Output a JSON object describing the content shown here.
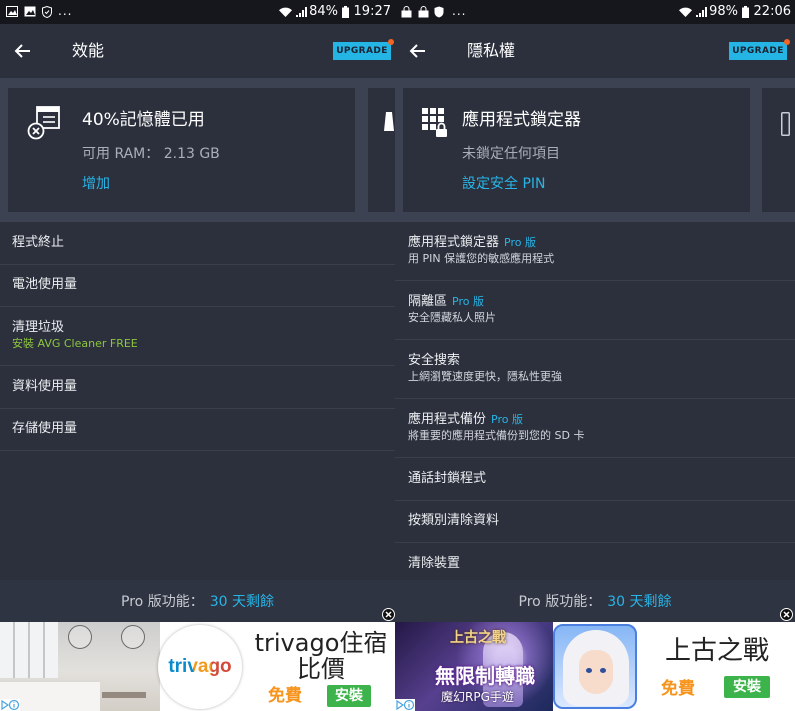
{
  "theme": {
    "background": "#2b303c",
    "card_area": "#3c4251",
    "card": "#2c303d",
    "accent": "#28b4e6",
    "upgrade_dot": "#f26522",
    "cleaner_green": "#8dc63f",
    "free_orange": "#f7941d",
    "install_green": "#3cb44b"
  },
  "left": {
    "status_bar": {
      "icons": [
        "gallery-icon",
        "image-icon",
        "shield-icon",
        "wifi-icon",
        "signal-icon",
        "battery-icon"
      ],
      "more": "...",
      "battery": "84%",
      "time": "19:27"
    },
    "app_bar": {
      "back_icon": "back-arrow-icon",
      "title": "效能",
      "upgrade": "UPGRADE"
    },
    "card": {
      "icon": "memory-icon",
      "title": "40%記憶體已用",
      "subtitle": "可用 RAM： 2.13 GB",
      "action": "增加"
    },
    "list": [
      {
        "title": "程式終止"
      },
      {
        "title": "電池使用量"
      },
      {
        "title": "清理垃圾",
        "subtitle": "安裝 AVG Cleaner FREE"
      },
      {
        "title": "資料使用量"
      },
      {
        "title": "存儲使用量"
      }
    ],
    "pro_bar": {
      "label": "Pro 版功能：",
      "remaining": "30 天剩餘"
    },
    "ad": {
      "logo": "trivago",
      "title_line1": "trivago住宿",
      "title_line2": "比價",
      "price": "免費",
      "install": "安裝"
    }
  },
  "right": {
    "status_bar": {
      "icons": [
        "lock-bag-icon",
        "lock-bag-icon",
        "shield-icon",
        "wifi-icon",
        "signal-icon",
        "battery-icon"
      ],
      "more": "...",
      "battery": "98%",
      "time": "22:06"
    },
    "app_bar": {
      "back_icon": "back-arrow-icon",
      "title": "隱私權",
      "upgrade": "UPGRADE"
    },
    "card": {
      "icon": "app-lock-grid-icon",
      "title": "應用程式鎖定器",
      "subtitle": "未鎖定任何項目",
      "action": "設定安全 PIN"
    },
    "list": [
      {
        "title": "應用程式鎖定器",
        "tag": "Pro 版",
        "subtitle": "用 PIN 保護您的敏感應用程式"
      },
      {
        "title": "隔離區",
        "tag": "Pro 版",
        "subtitle": "安全隱藏私人照片"
      },
      {
        "title": "安全搜索",
        "subtitle": "上網瀏覽速度更快，隱私性更強"
      },
      {
        "title": "應用程式備份",
        "tag": "Pro 版",
        "subtitle": "將重要的應用程式備份到您的 SD 卡"
      },
      {
        "title": "通話封鎖程式"
      },
      {
        "title": "按類別清除資料"
      },
      {
        "title": "清除裝置"
      }
    ],
    "pro_bar": {
      "label": "Pro 版功能：",
      "remaining": "30 天剩餘"
    },
    "ad": {
      "image_logo": "上古之戰",
      "image_line1": "無限制轉職",
      "image_line2": "魔幻RPG手遊",
      "title": "上古之戰",
      "price": "免費",
      "install": "安裝"
    }
  }
}
